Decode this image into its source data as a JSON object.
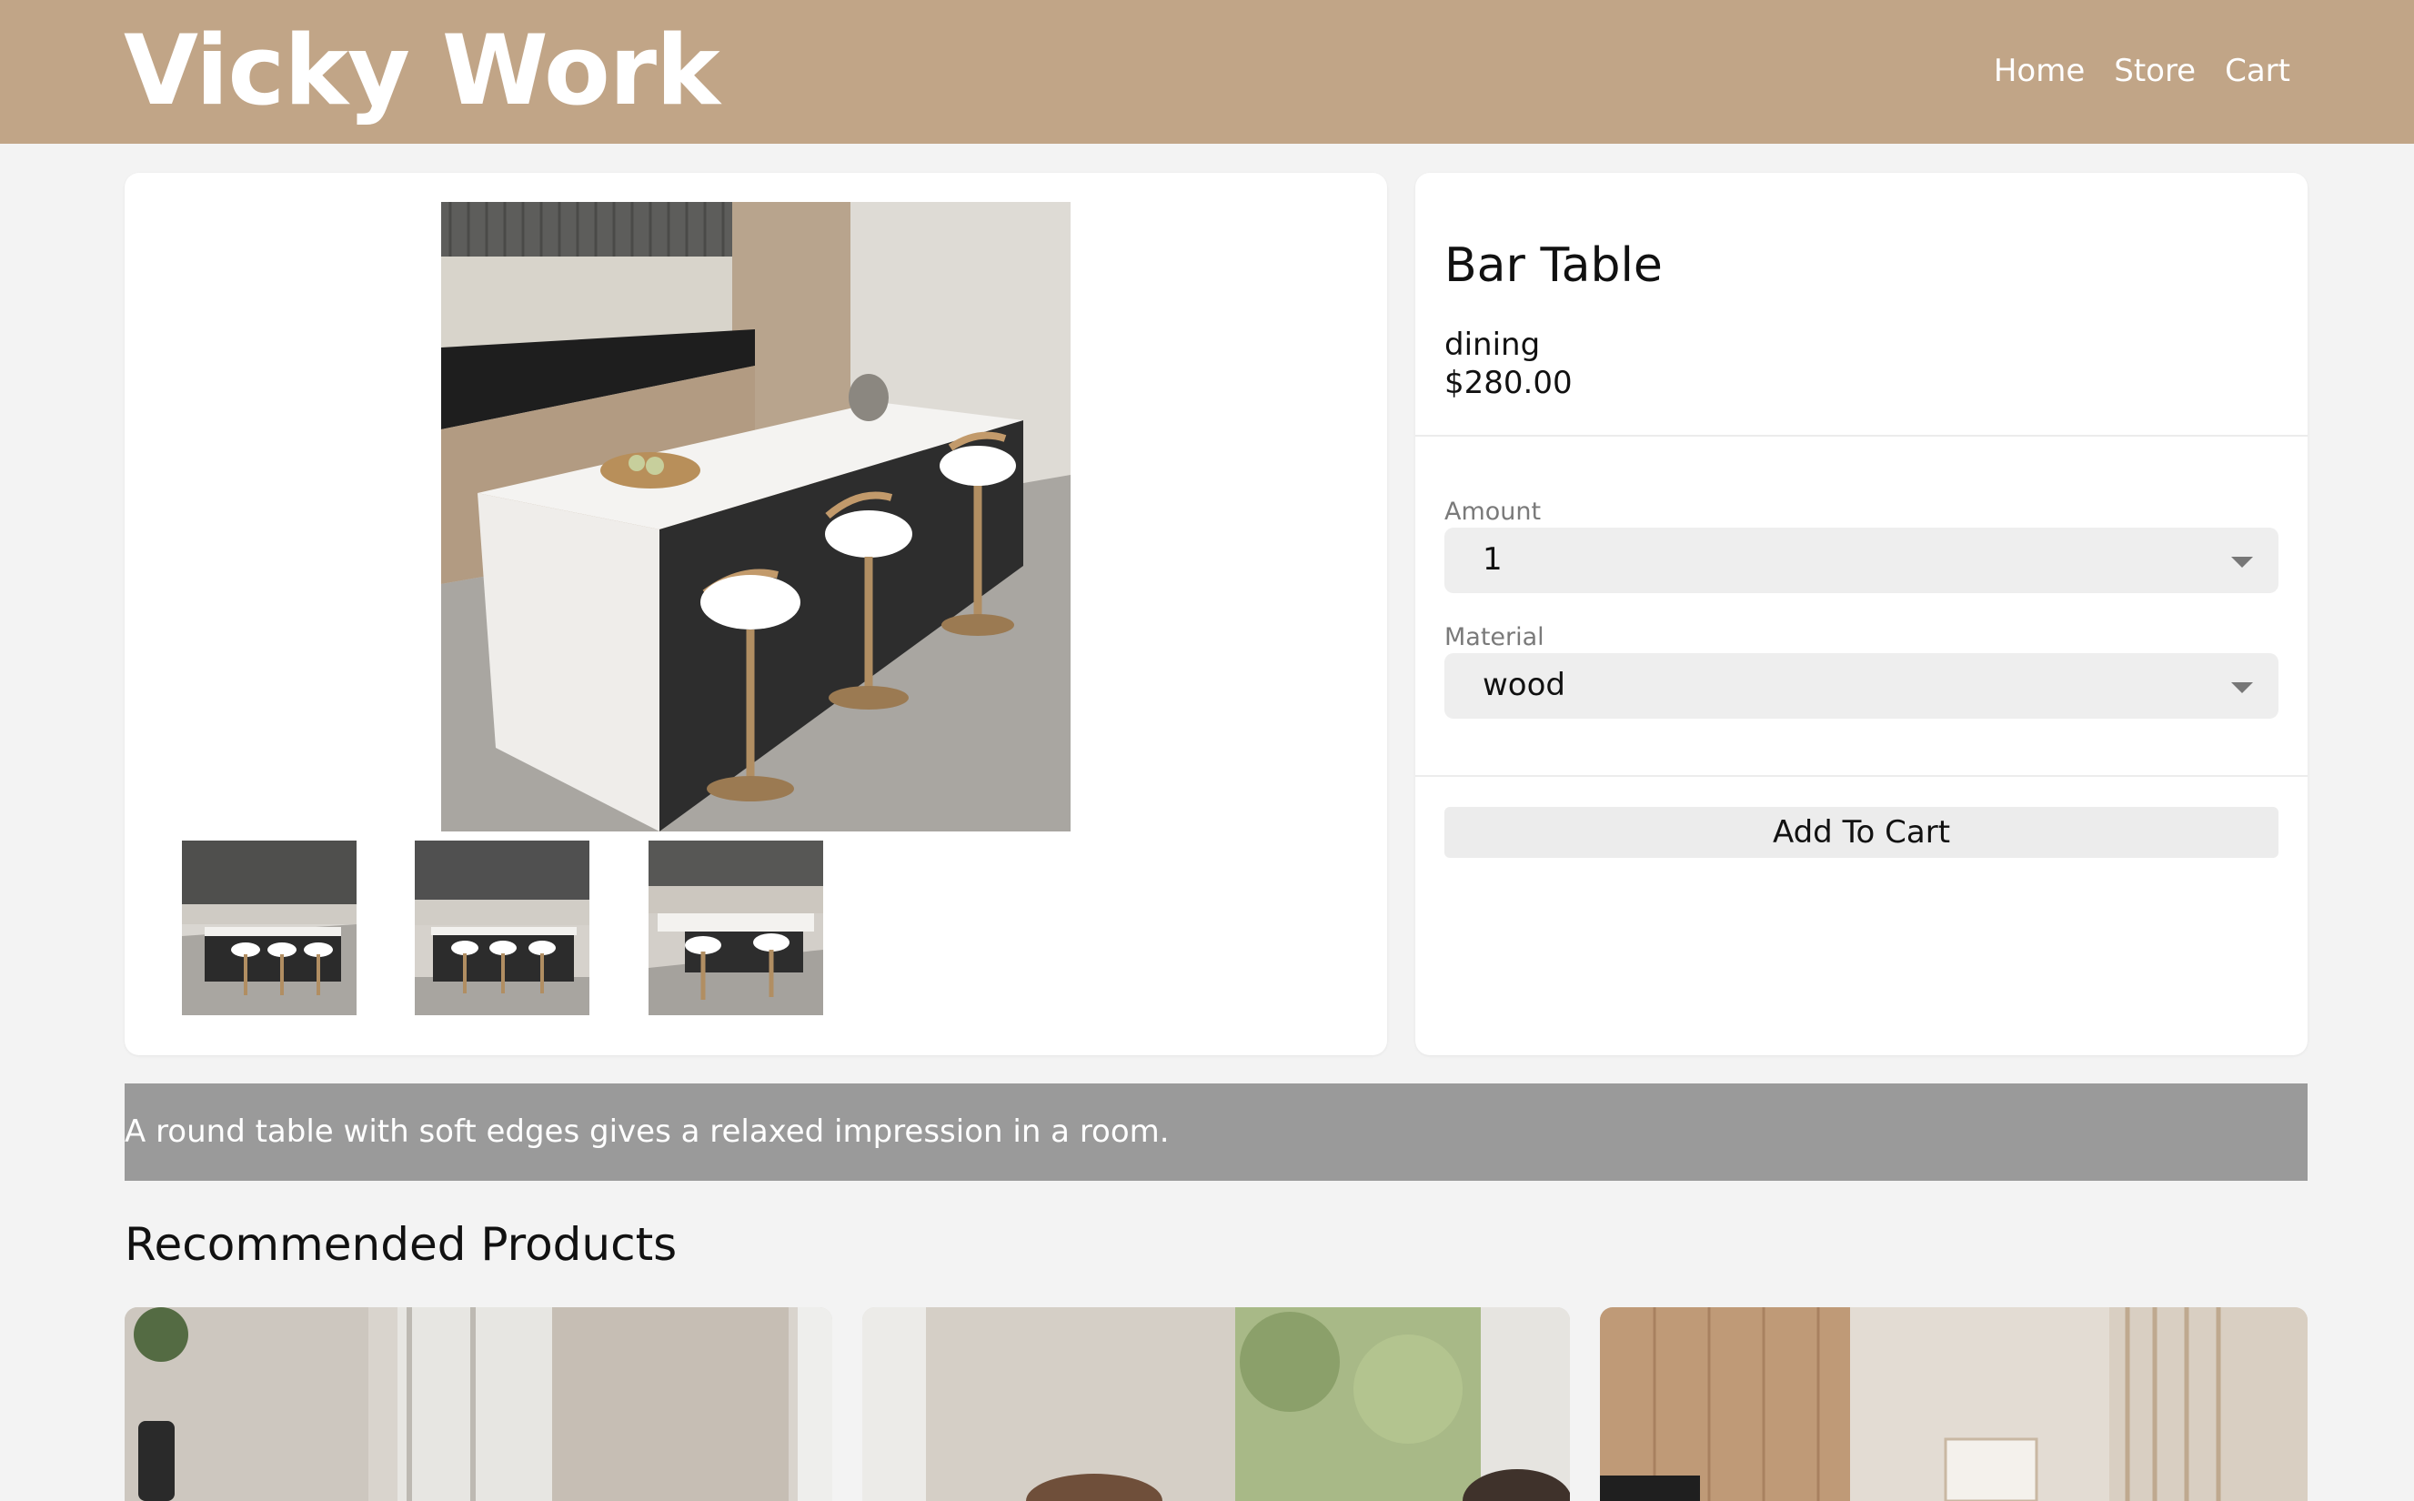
{
  "header": {
    "brand": "Vicky Work",
    "nav": [
      {
        "label": "Home"
      },
      {
        "label": "Store"
      },
      {
        "label": "Cart"
      }
    ]
  },
  "product": {
    "title": "Bar Table",
    "category": "dining",
    "price": "$280.00",
    "amount_label": "Amount",
    "amount_value": "1",
    "material_label": "Material",
    "material_value": "wood",
    "add_to_cart": "Add To Cart",
    "description": "A round table with soft edges gives a relaxed impression in a room."
  },
  "recommended": {
    "title": "Recommended Products"
  },
  "colors": {
    "header_bg": "#c1a587",
    "page_bg": "#f3f3f3",
    "description_bg": "#9a9a9a"
  }
}
